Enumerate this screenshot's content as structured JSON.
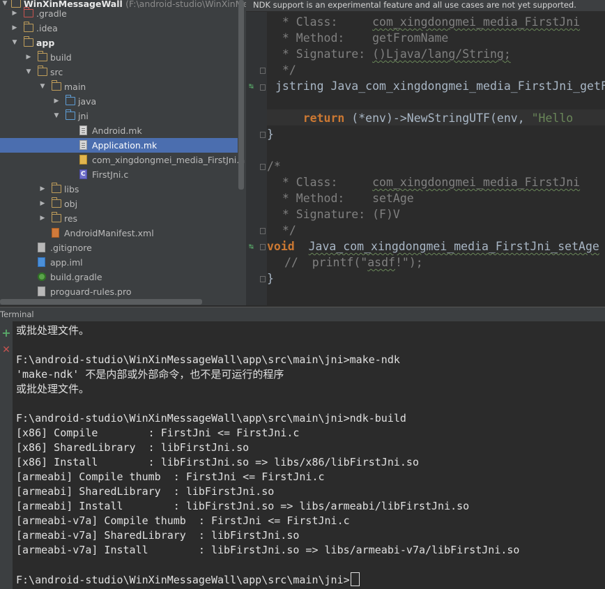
{
  "project": {
    "root_label": "WinXinMessageWall",
    "root_path": "(F:\\android-studio\\WinXinMes",
    "tree": [
      {
        "label": ".gradle",
        "kind": "folder-red",
        "arrow": "right"
      },
      {
        "label": ".idea",
        "kind": "folder",
        "arrow": "right"
      },
      {
        "label": "app",
        "kind": "folder",
        "arrow": "down",
        "bold": true
      },
      {
        "label": "build",
        "kind": "folder",
        "arrow": "right"
      },
      {
        "label": "src",
        "kind": "folder",
        "arrow": "down"
      },
      {
        "label": "main",
        "kind": "folder",
        "arrow": "down"
      },
      {
        "label": "java",
        "kind": "folder-blue",
        "arrow": "right"
      },
      {
        "label": "jni",
        "kind": "folder-blue",
        "arrow": "down"
      },
      {
        "label": "Android.mk",
        "kind": "file-mk"
      },
      {
        "label": "Application.mk",
        "kind": "file-mk",
        "selected": true
      },
      {
        "label": "com_xingdongmei_media_FirstJni.h",
        "kind": "file-h"
      },
      {
        "label": "FirstJni.c",
        "kind": "file-c"
      },
      {
        "label": "libs",
        "kind": "folder",
        "arrow": "right"
      },
      {
        "label": "obj",
        "kind": "folder",
        "arrow": "right"
      },
      {
        "label": "res",
        "kind": "folder",
        "arrow": "right"
      },
      {
        "label": "AndroidManifest.xml",
        "kind": "file-xml"
      },
      {
        "label": ".gitignore",
        "kind": "file-plain"
      },
      {
        "label": "app.iml",
        "kind": "file-iml"
      },
      {
        "label": "build.gradle",
        "kind": "gradle"
      },
      {
        "label": "proguard-rules.pro",
        "kind": "file-plain"
      }
    ]
  },
  "editor": {
    "notice": "NDK support is an experimental feature and all use cases are not yet supported.",
    "code": {
      "l1_label": " * Class:",
      "l1_value": "com_xingdongmei_media_FirstJni",
      "l2_label": " * Method:",
      "l2_value": "getFromName",
      "l3_label": " * Signature:",
      "l3_value": "()Ljava/lang/String;",
      "l4": " */",
      "l5_type": "jstring",
      "l5_name": "Java_com_xingdongmei_media_FirstJni_getFromName",
      "l6_kw": "return",
      "l6_call": "(*env)->NewStringUTF(env,",
      "l6_str": "\"Hello",
      "l7": "}",
      "l8": "/*",
      "l9_label": " * Class:",
      "l9_value": "com_xingdongmei_media_FirstJni",
      "l10_label": " * Method:",
      "l10_value": "setAge",
      "l11_label": " * Signature:",
      "l11_value": "(F)V",
      "l12": " */",
      "l13_kw": "void",
      "l13_name": "Java_com_xingdongmei_media_FirstJni_setAge",
      "l14_cmt": "//",
      "l14_call": "printf(\"",
      "l14_arg": "asdf",
      "l14_end": "!\");",
      "l15": "}"
    }
  },
  "terminal": {
    "title": "Terminal",
    "add_label": "+",
    "close_label": "✕",
    "lines": [
      "或批处理文件。",
      "",
      "F:\\android-studio\\WinXinMessageWall\\app\\src\\main\\jni>make-ndk",
      "'make-ndk' 不是内部或外部命令，也不是可运行的程序",
      "或批处理文件。",
      "",
      "F:\\android-studio\\WinXinMessageWall\\app\\src\\main\\jni>ndk-build",
      "[x86] Compile        : FirstJni <= FirstJni.c",
      "[x86] SharedLibrary  : libFirstJni.so",
      "[x86] Install        : libFirstJni.so => libs/x86/libFirstJni.so",
      "[armeabi] Compile thumb  : FirstJni <= FirstJni.c",
      "[armeabi] SharedLibrary  : libFirstJni.so",
      "[armeabi] Install        : libFirstJni.so => libs/armeabi/libFirstJni.so",
      "[armeabi-v7a] Compile thumb  : FirstJni <= FirstJni.c",
      "[armeabi-v7a] SharedLibrary  : libFirstJni.so",
      "[armeabi-v7a] Install        : libFirstJni.so => libs/armeabi-v7a/libFirstJni.so",
      "",
      "F:\\android-studio\\WinXinMessageWall\\app\\src\\main\\jni>"
    ]
  },
  "colors": {
    "panel": "#3c3f41",
    "editor_bg": "#2b2b2b",
    "selection": "#4b6eaf",
    "keyword": "#cc7832",
    "string": "#6a8759",
    "comment": "#808080"
  }
}
